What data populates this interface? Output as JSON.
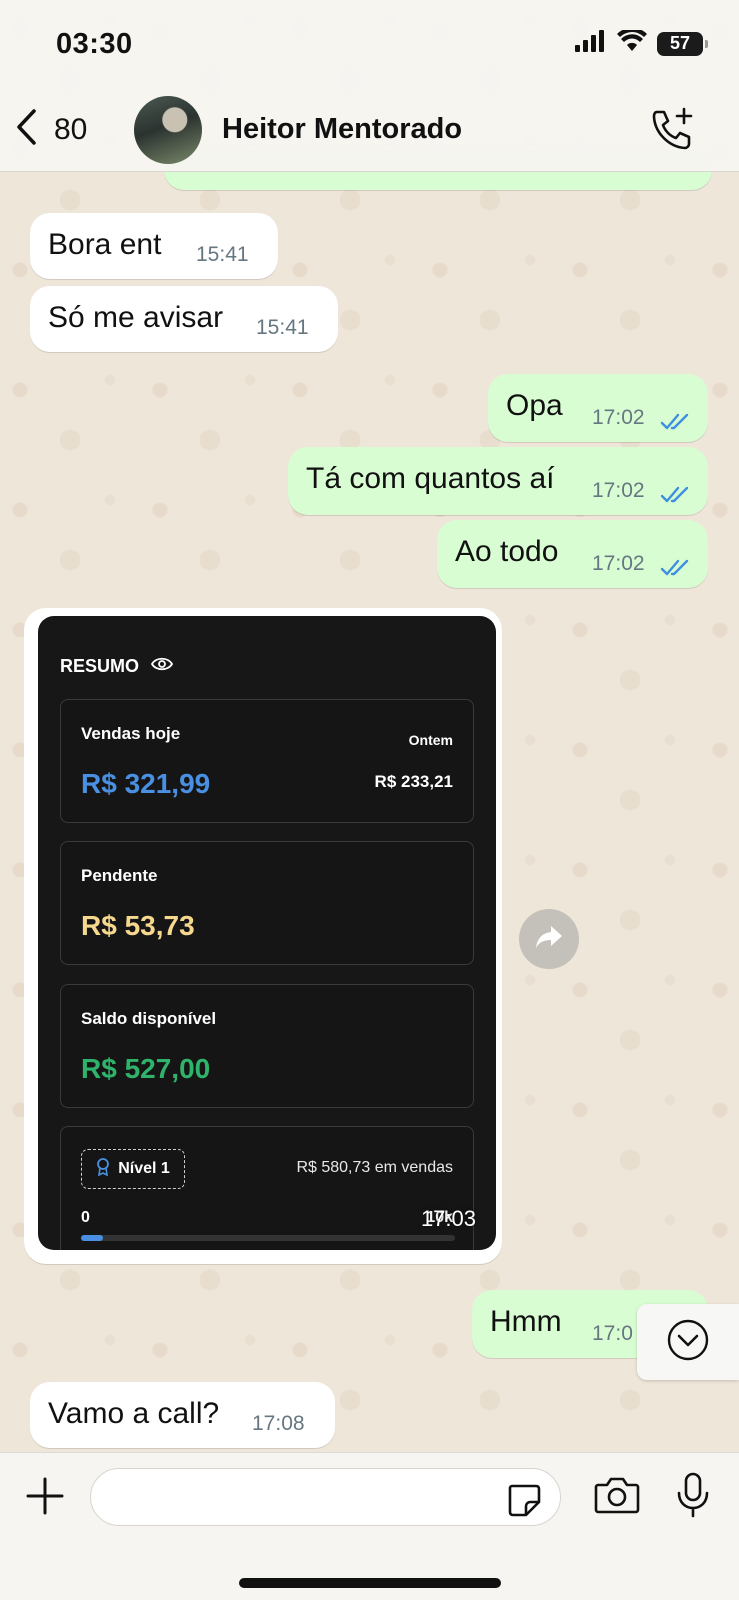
{
  "status_bar": {
    "time": "03:30",
    "battery": "57"
  },
  "header": {
    "back_count": "80",
    "contact_name": "Heitor Mentorado"
  },
  "messages": [
    {
      "dir": "in",
      "text": "Bora ent",
      "time": "15:41"
    },
    {
      "dir": "in",
      "text": "Só me avisar",
      "time": "15:41"
    },
    {
      "dir": "out",
      "text": "Opa",
      "time": "17:02",
      "read": true
    },
    {
      "dir": "out",
      "text": "Tá com quantos aí",
      "time": "17:02",
      "read": true
    },
    {
      "dir": "out",
      "text": "Ao todo",
      "time": "17:02",
      "read": true
    },
    {
      "dir": "out",
      "text": "Hmm",
      "time": "17:0",
      "read": true
    },
    {
      "dir": "in",
      "text": "Vamo a call?",
      "time": "17:08"
    }
  ],
  "image_message": {
    "time": "17:03",
    "summary_title": "RESUMO",
    "sales_today": {
      "label": "Vendas hoje",
      "value": "R$ 321,99",
      "yesterday_label": "Ontem",
      "yesterday_value": "R$ 233,21"
    },
    "pending": {
      "label": "Pendente",
      "value": "R$ 53,73"
    },
    "balance": {
      "label": "Saldo disponível",
      "value": "R$ 527,00"
    },
    "level": {
      "badge": "Nível 1",
      "sales_text": "R$ 580,73 em vendas",
      "min": "0",
      "max": "10k",
      "progress": 0.058
    },
    "colors": {
      "sales": "#4a90e2",
      "pending": "#f5d78e",
      "balance": "#2fb36a"
    }
  },
  "composer": {
    "placeholder": ""
  }
}
